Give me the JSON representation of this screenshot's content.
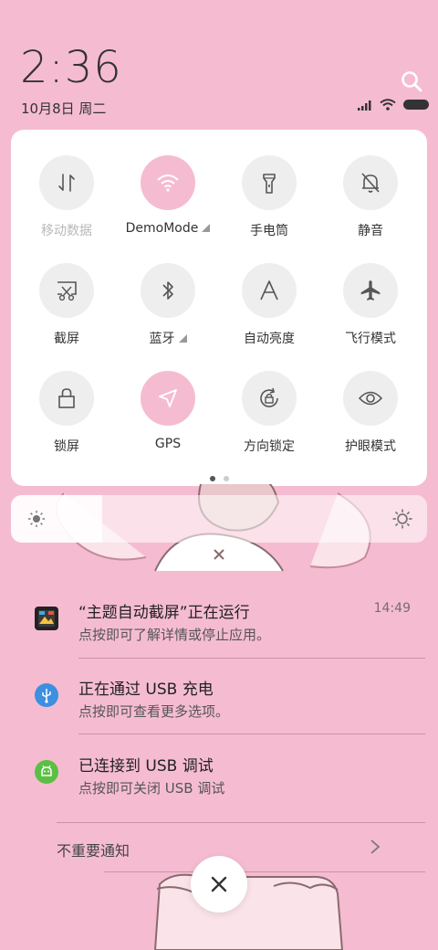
{
  "header": {
    "time": "2:36",
    "date": "10月8日 周二"
  },
  "icons": {
    "search": "search-icon",
    "signal": "signal-icon",
    "wifi": "wifi-icon",
    "battery": "battery-icon"
  },
  "colors": {
    "background": "#f5bcd1",
    "active_tile": "#f5bcd1",
    "inactive_tile": "#eeeeee",
    "panel": "#ffffff"
  },
  "quick_settings": {
    "tiles": [
      {
        "label": "移动数据",
        "icon": "data-transfer-icon",
        "active": false,
        "dim": true
      },
      {
        "label": "DemoMode",
        "icon": "wifi-icon",
        "active": true,
        "expandable": true
      },
      {
        "label": "手电筒",
        "icon": "flashlight-icon",
        "active": false
      },
      {
        "label": "静音",
        "icon": "mute-bell-icon",
        "active": false
      },
      {
        "label": "截屏",
        "icon": "screenshot-icon",
        "active": false
      },
      {
        "label": "蓝牙",
        "icon": "bluetooth-icon",
        "active": false,
        "expandable": true
      },
      {
        "label": "自动亮度",
        "icon": "auto-brightness-icon",
        "active": false
      },
      {
        "label": "飞行模式",
        "icon": "airplane-icon",
        "active": false
      },
      {
        "label": "锁屏",
        "icon": "lock-icon",
        "active": false
      },
      {
        "label": "GPS",
        "icon": "gps-icon",
        "active": true
      },
      {
        "label": "方向锁定",
        "icon": "rotation-lock-icon",
        "active": false
      },
      {
        "label": "护眼模式",
        "icon": "eye-icon",
        "active": false
      }
    ],
    "page_count": 2,
    "current_page": 1
  },
  "brightness": {
    "level": 0.22
  },
  "notifications": [
    {
      "title": "“主题自动截屏”正在运行",
      "body": "点按即可了解详情或停止应用。",
      "time": "14:49",
      "icon": "theme-app-icon"
    },
    {
      "title": "正在通过 USB 充电",
      "body": "点按即可查看更多选项。",
      "icon": "usb-icon"
    },
    {
      "title": "已连接到 USB 调试",
      "body": "点按即可关闭 USB 调试",
      "icon": "android-debug-icon"
    }
  ],
  "unimportant": {
    "label": "不重要通知"
  }
}
